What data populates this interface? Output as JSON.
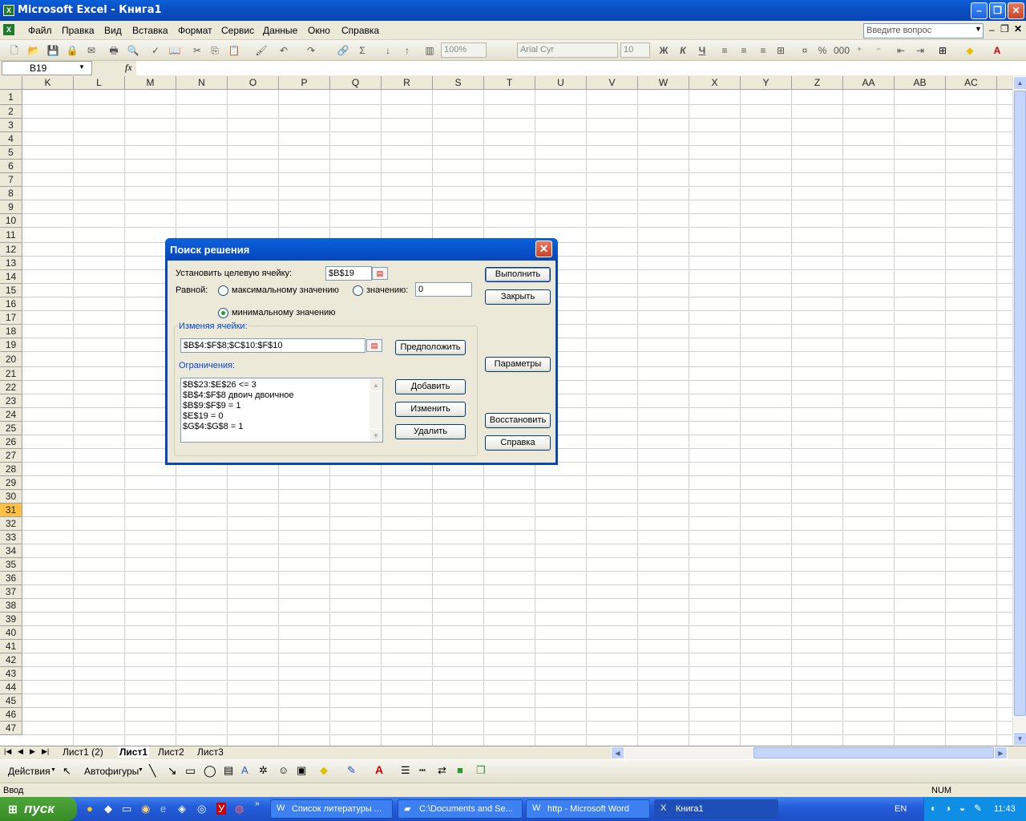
{
  "window": {
    "title": "Microsoft Excel - Книга1"
  },
  "menu": {
    "items": [
      "Файл",
      "Правка",
      "Вид",
      "Вставка",
      "Формат",
      "Сервис",
      "Данные",
      "Окно",
      "Справка"
    ],
    "help_placeholder": "Введите вопрос"
  },
  "toolbar": {
    "zoom": "100%",
    "font": "Arial Cyr",
    "font_size": "10",
    "bold": "Ж",
    "italic": "К",
    "underline": "Ч",
    "percent": "%",
    "thousands": "000"
  },
  "formula_bar": {
    "name_box": "B19",
    "fx": "fx",
    "content": ""
  },
  "sheet": {
    "columns": [
      "K",
      "L",
      "M",
      "N",
      "O",
      "P",
      "Q",
      "R",
      "S",
      "T",
      "U",
      "V",
      "W",
      "X",
      "Y",
      "Z",
      "AA",
      "AB",
      "AC"
    ],
    "rows": [
      "1",
      "2",
      "3",
      "4",
      "5",
      "6",
      "7",
      "8",
      "9",
      "10",
      "11",
      "12",
      "13",
      "14",
      "15",
      "16",
      "17",
      "18",
      "19",
      "20",
      "21",
      "22",
      "23",
      "24",
      "25",
      "26",
      "27",
      "28",
      "29",
      "30",
      "31",
      "32",
      "33",
      "34",
      "35",
      "36",
      "37",
      "38",
      "39",
      "40",
      "41",
      "42",
      "43",
      "44",
      "45",
      "46",
      "47"
    ],
    "selected_row": "31"
  },
  "tabs": [
    "Лист1 (2)",
    "Лист1",
    "Лист2",
    "Лист3"
  ],
  "active_tab": "Лист1",
  "drawing": {
    "actions": "Действия",
    "autoshapes": "Автофигуры"
  },
  "status": {
    "mode": "Ввод",
    "num": "NUM"
  },
  "taskbar": {
    "start": "пуск",
    "tasks": [
      "Список литературы ...",
      "C:\\Documents and Se...",
      "http - Microsoft Word",
      "Книга1"
    ],
    "lang": "EN",
    "time": "11:43"
  },
  "dialog": {
    "title": "Поиск решения",
    "target_label": "Установить целевую ячейку:",
    "target_value": "$B$19",
    "equal_label": "Равной:",
    "max_label": "максимальному значению",
    "value_label": "значению:",
    "value_field": "0",
    "min_label": "минимальному значению",
    "selected_option": "min",
    "changing_group": "Изменяя ячейки:",
    "changing_value": "$B$4:$F$8;$C$10:$F$10",
    "guess_button": "Предположить",
    "constraints_group": "Ограничения:",
    "constraints": [
      "$B$23:$E$26 <= 3",
      "$B$4:$F$8 двоич двоичное",
      "$B$9:$F$9 = 1",
      "$E$19 = 0",
      "$G$4:$G$8 = 1"
    ],
    "buttons": {
      "run": "Выполнить",
      "close": "Закрыть",
      "params": "Параметры",
      "restore": "Восстановить",
      "help": "Справка",
      "add": "Добавить",
      "change": "Изменить",
      "delete": "Удалить"
    }
  }
}
